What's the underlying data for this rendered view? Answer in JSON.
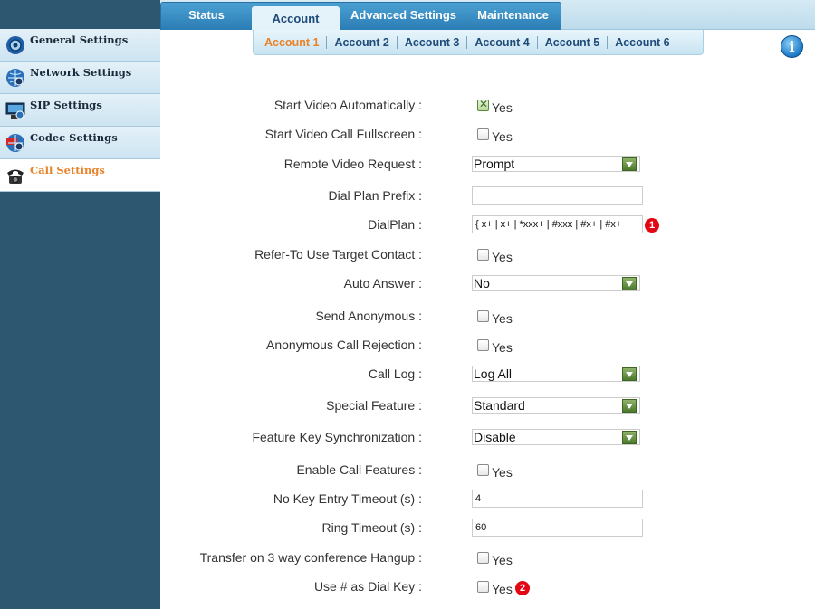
{
  "nav": {
    "tabs": [
      {
        "label": "Status"
      },
      {
        "label": "Account"
      },
      {
        "label": "Advanced Settings"
      },
      {
        "label": "Maintenance"
      }
    ],
    "active_tab": "Account"
  },
  "account_tabs": [
    {
      "label": "Account 1"
    },
    {
      "label": "Account 2"
    },
    {
      "label": "Account 3"
    },
    {
      "label": "Account 4"
    },
    {
      "label": "Account 5"
    },
    {
      "label": "Account 6"
    }
  ],
  "info_icon": {
    "glyph": "i"
  },
  "sidebar": {
    "items": [
      {
        "label": "General Settings",
        "icon": "gear-globe-icon"
      },
      {
        "label": "Network Settings",
        "icon": "network-globe-icon"
      },
      {
        "label": "SIP Settings",
        "icon": "sip-computer-icon"
      },
      {
        "label": "Codec Settings",
        "icon": "codec-globe-icon"
      },
      {
        "label": "Call Settings",
        "icon": "telephone-icon"
      }
    ],
    "active": "Call Settings"
  },
  "form": {
    "start_video_auto": {
      "label": "Start Video Automatically :",
      "checked": true,
      "text": "Yes"
    },
    "start_video_fullscreen": {
      "label": "Start Video Call Fullscreen :",
      "checked": false,
      "text": "Yes"
    },
    "remote_video_request": {
      "label": "Remote Video Request :",
      "value": "Prompt"
    },
    "dial_plan_prefix": {
      "label": "Dial Plan Prefix :",
      "value": ""
    },
    "dialplan": {
      "label": "DialPlan :",
      "value": "{ x+ | x+ | *xxx+ | #xxx | #x+ | #x+",
      "badge": "1"
    },
    "refer_to": {
      "label": "Refer-To Use Target Contact :",
      "checked": false,
      "text": "Yes"
    },
    "auto_answer": {
      "label": "Auto Answer :",
      "value": "No"
    },
    "send_anonymous": {
      "label": "Send Anonymous :",
      "checked": false,
      "text": "Yes"
    },
    "anon_rejection": {
      "label": "Anonymous Call Rejection :",
      "checked": false,
      "text": "Yes"
    },
    "call_log": {
      "label": "Call Log :",
      "value": "Log All"
    },
    "special_feature": {
      "label": "Special Feature :",
      "value": "Standard"
    },
    "feature_key_sync": {
      "label": "Feature Key Synchronization :",
      "value": "Disable"
    },
    "enable_call_features": {
      "label": "Enable Call Features :",
      "checked": false,
      "text": "Yes"
    },
    "no_key_timeout": {
      "label": "No Key Entry Timeout (s) :",
      "value": "4"
    },
    "ring_timeout": {
      "label": "Ring Timeout (s) :",
      "value": "60"
    },
    "transfer_hangup": {
      "label": "Transfer on 3 way conference Hangup :",
      "checked": false,
      "text": "Yes"
    },
    "use_hash": {
      "label": "Use # as Dial Key :",
      "checked": false,
      "text": "Yes",
      "badge": "2"
    }
  },
  "colors": {
    "accent_orange": "#e8832a",
    "nav_blue": "#2b7db5",
    "sidebar_dark": "#2d5670",
    "badge_red": "#e30613",
    "select_green": "#4c7a2c"
  }
}
